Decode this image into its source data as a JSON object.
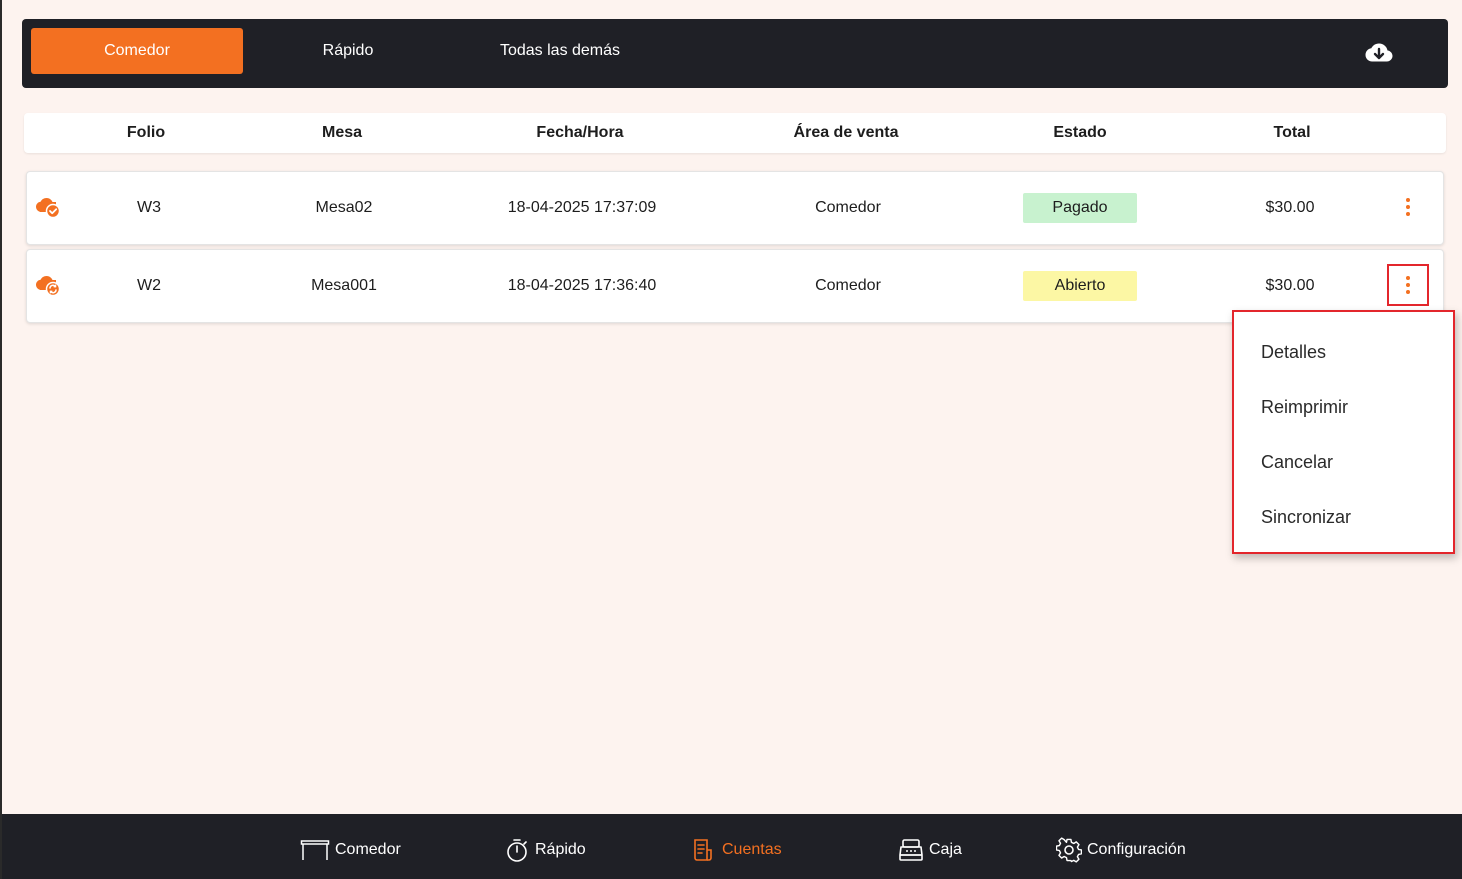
{
  "tabs": [
    {
      "label": "Comedor",
      "active": true
    },
    {
      "label": "Rápido",
      "active": false
    },
    {
      "label": "Todas las demás",
      "active": false
    }
  ],
  "download_icon": "cloud-download-icon",
  "table": {
    "headers": [
      "Folio",
      "Mesa",
      "Fecha/Hora",
      "Área de venta",
      "Estado",
      "Total"
    ],
    "rows": [
      {
        "sync_icon": "cloud-check-icon",
        "folio": "W3",
        "mesa": "Mesa02",
        "fecha": "18-04-2025 17:37:09",
        "area": "Comedor",
        "estado": "Pagado",
        "estado_color": "#c8f2cf",
        "total": "$30.00"
      },
      {
        "sync_icon": "cloud-sync-icon",
        "folio": "W2",
        "mesa": "Mesa001",
        "fecha": "18-04-2025 17:36:40",
        "area": "Comedor",
        "estado": "Abierto",
        "estado_color": "#fcf7a4",
        "total": "$30.00"
      }
    ]
  },
  "context_menu": {
    "items": [
      "Detalles",
      "Reimprimir",
      "Cancelar",
      "Sincronizar"
    ]
  },
  "bottom_nav": [
    {
      "label": "Comedor",
      "icon": "table-icon",
      "active": false
    },
    {
      "label": "Rápido",
      "icon": "stopwatch-icon",
      "active": false
    },
    {
      "label": "Cuentas",
      "icon": "receipt-icon",
      "active": true
    },
    {
      "label": "Caja",
      "icon": "cash-register-icon",
      "active": false
    },
    {
      "label": "Configuración",
      "icon": "gear-icon",
      "active": false
    }
  ],
  "colors": {
    "accent": "#f37021",
    "dark": "#1f2026",
    "background": "#fdf3ef",
    "highlight": "#e3262c"
  }
}
